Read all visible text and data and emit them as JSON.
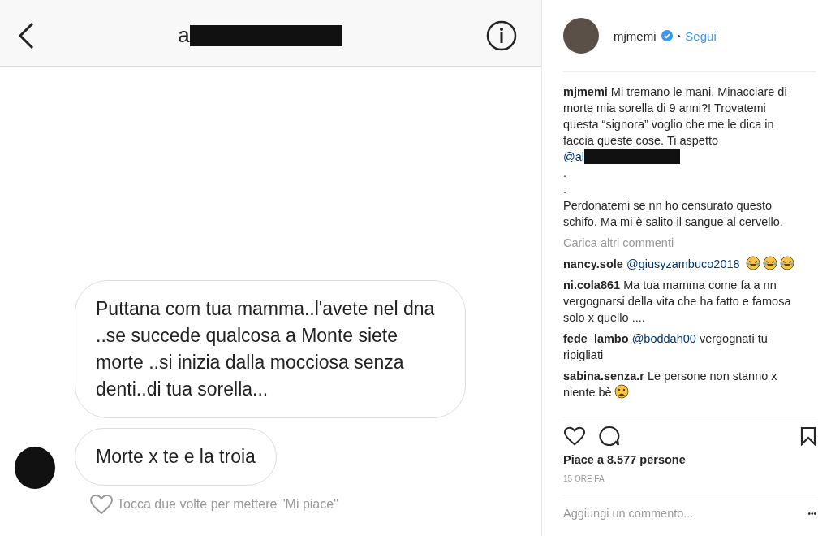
{
  "chat": {
    "title": "a",
    "messages": [
      {
        "text": "Puttana com tua mamma..l'avete  nel dna ..se succede qualcosa a Monte siete morte ..si inizia dalla mocciosa senza denti..di tua sorella...",
        "avatar": false
      },
      {
        "text": "Morte x te e la troia",
        "avatar": true
      }
    ],
    "like_hint": "Tocca due volte per mettere \"Mi piace\""
  },
  "post": {
    "user": "mjmemi",
    "verified": true,
    "separator": "•",
    "follow": "Segui",
    "caption": {
      "user": "mjmemi",
      "lines": [
        "Mi tremano le mani. Minacciare di morte mia sorella di 9 anni?! Trovatemi questa “signora” voglio che me le dica in faccia queste cose. Ti aspetto"
      ],
      "mention": "@al",
      "after": [
        ".",
        ".",
        "Perdonatemi se nn ho censurato questo schifo. Ma mi è salito il sangue al cervello."
      ]
    },
    "load_more": "Carica altri commenti",
    "comments": [
      {
        "user": "nancy.sole",
        "mention": "@giusyzambuco2018",
        "emoji": [
          {
            "kind": "laughing"
          },
          {
            "kind": "laughing"
          },
          {
            "kind": "laughing"
          }
        ]
      },
      {
        "user": "ni.cola861",
        "text": "Ma tua mamma come fa a nn vergognarsi della vita che ha fatto e famosa solo x quello ...."
      },
      {
        "user": "fede_lambo",
        "mention": "@boddah00",
        "text": "vergognati tu ripigliati"
      },
      {
        "user": "sabina.senza.r",
        "text": "Le persone non stanno x niente bè",
        "emoji": [
          {
            "kind": "frowning"
          }
        ]
      }
    ],
    "likes": "Piace a 8.577 persone",
    "time": "15 ORE FA",
    "add_comment": {
      "placeholder": "Aggiungi un commento..."
    },
    "more": "•••"
  }
}
